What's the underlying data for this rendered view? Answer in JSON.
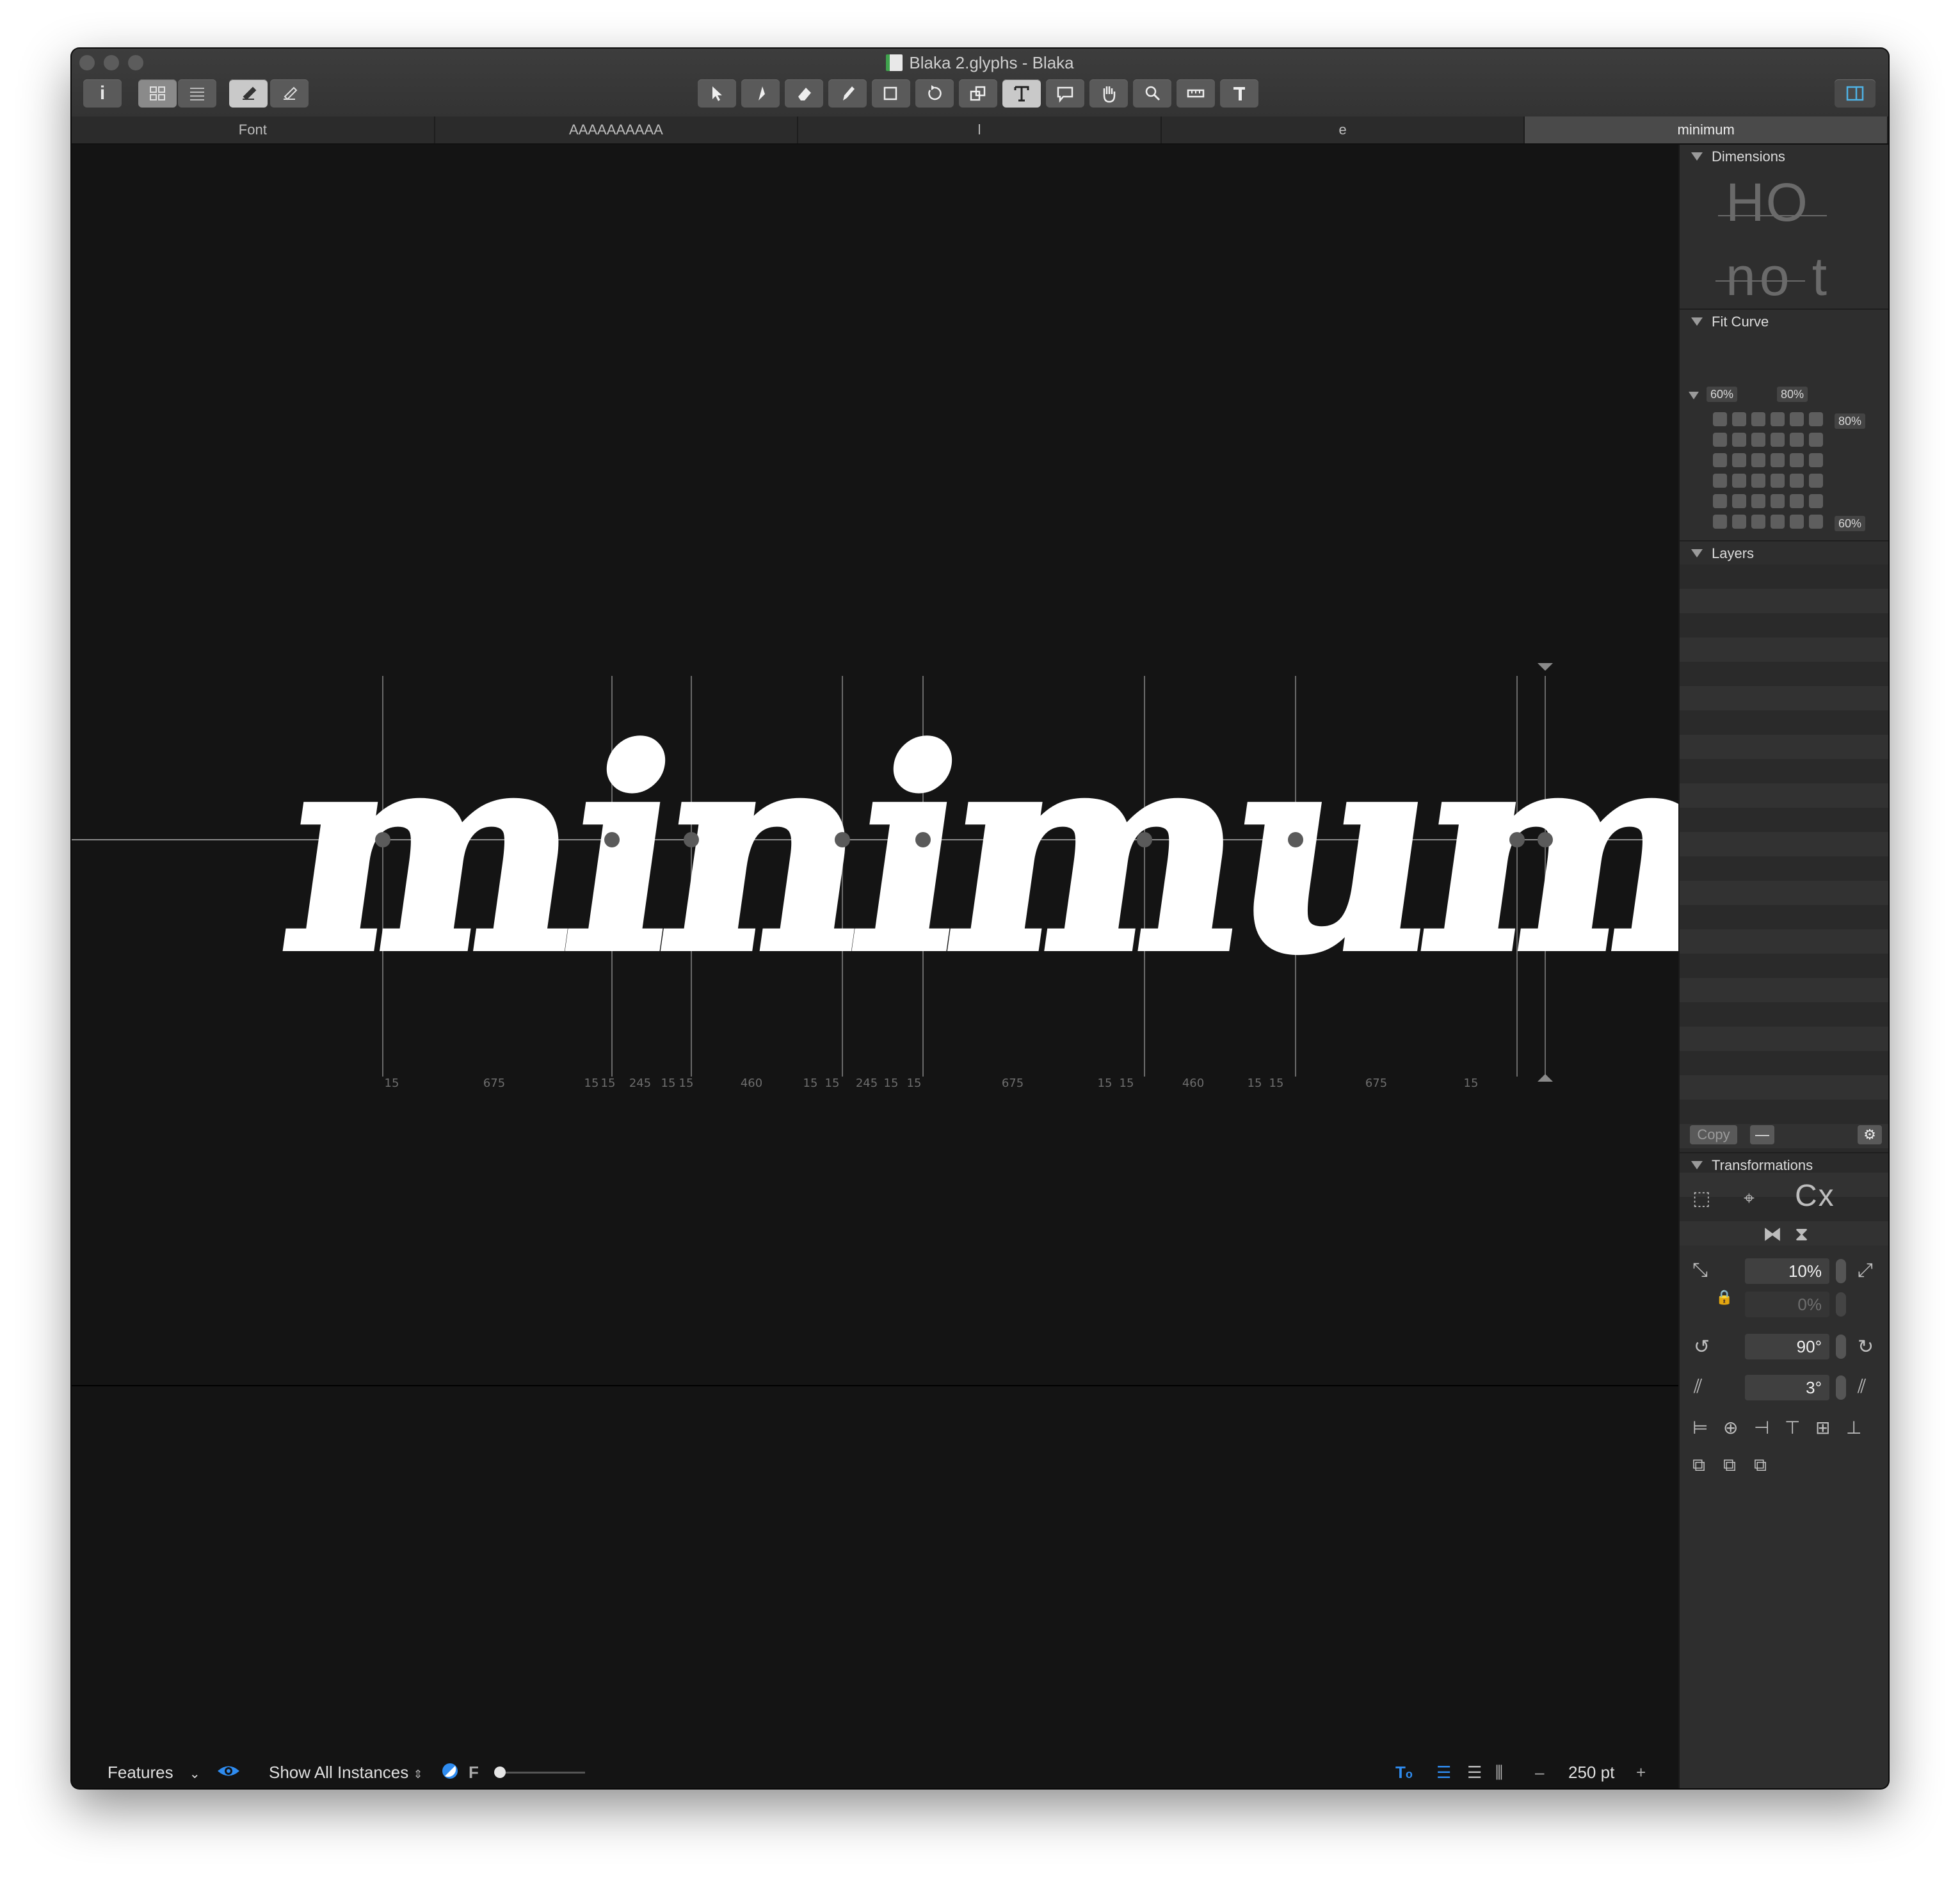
{
  "window": {
    "title": "Blaka 2.glyphs - Blaka"
  },
  "tabs": [
    {
      "label": "Font"
    },
    {
      "label": "AAAAAAAAAA"
    },
    {
      "label": "l"
    },
    {
      "label": "e"
    },
    {
      "label": "minimum",
      "active": true
    }
  ],
  "toolbar": {
    "left_tools": [
      "info-icon",
      "grid-view-icon",
      "list-view-icon",
      "edit-view-icon",
      "preview-icon"
    ],
    "tools": [
      "select-tool-icon",
      "draw-tool-icon",
      "eraser-tool-icon",
      "pencil-tool-icon",
      "rectangle-tool-icon",
      "rotate-tool-icon",
      "scale-tool-icon",
      "text-tool-icon",
      "annotation-tool-icon",
      "hand-tool-icon",
      "zoom-tool-icon",
      "measure-tool-icon",
      "type-tool-icon"
    ],
    "selected_tool": "text-tool-icon"
  },
  "canvas": {
    "text": "minimum",
    "metric_labels": [
      "15",
      "675",
      "15",
      "15",
      "245",
      "15",
      "15",
      "460",
      "15",
      "15",
      "245",
      "15",
      "15",
      "675",
      "15",
      "15",
      "460",
      "15",
      "15",
      "675",
      "15"
    ]
  },
  "bottom_bar": {
    "features_label": "Features",
    "instances_label": "Show All Instances",
    "f_label": "F",
    "zoom_value": "250 pt",
    "zoom_minus": "–",
    "zoom_plus": "+"
  },
  "sidebar": {
    "dimensions": {
      "title": "Dimensions",
      "sample_top": "HO",
      "sample_bottom": "no t"
    },
    "fit_curve": {
      "title": "Fit Curve",
      "top_left": "60%",
      "top_right": "80%",
      "right_top": "80%",
      "right_bottom": "60%"
    },
    "layers": {
      "title": "Layers",
      "copy_label": "Copy",
      "remove_label": "—"
    },
    "transformations": {
      "title": "Transformations",
      "scale_value": "10%",
      "scale_value_2": "0%",
      "rotate_value": "90°",
      "slant_value": "3°",
      "symbol": "Cx"
    }
  }
}
